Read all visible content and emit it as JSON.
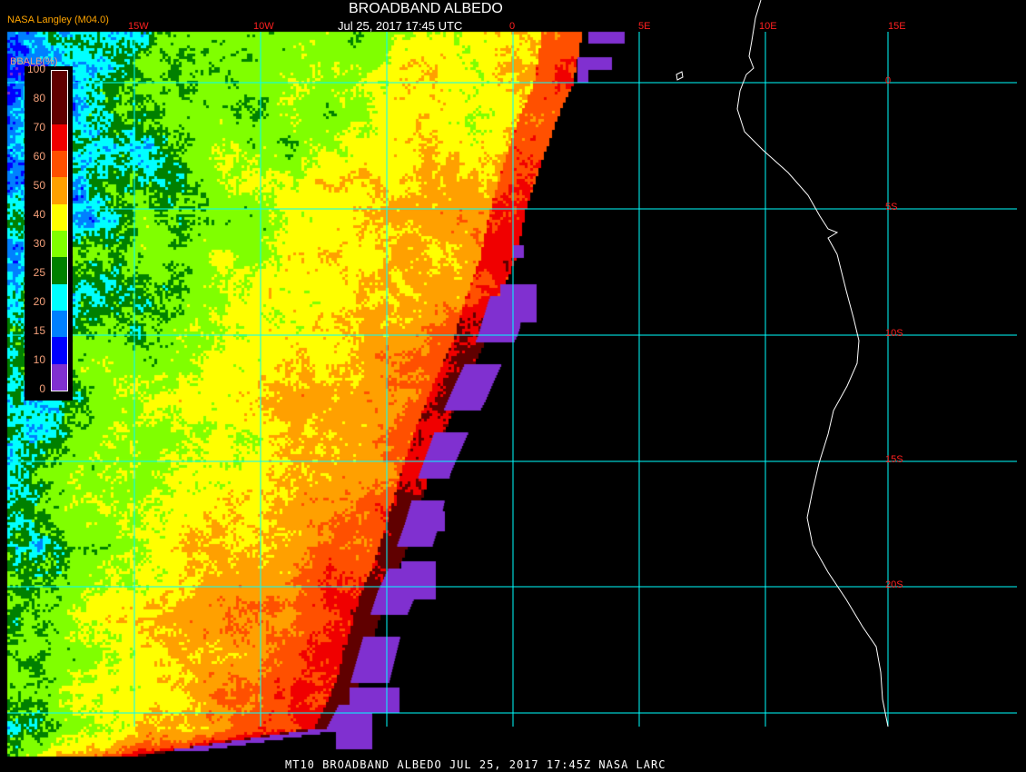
{
  "header": {
    "title": "BROADBAND ALBEDO",
    "subtitle": "Jul 25, 2017 17:45 UTC",
    "source": "NASA Langley (M04.0)"
  },
  "caption": "MT10  BROADBAND ALBEDO  JUL 25, 2017 17:45Z  NASA LARC",
  "longitude_labels": [
    "15W",
    "10W",
    "0",
    "5E",
    "10E",
    "15E"
  ],
  "latitude_labels": [
    "0",
    "5S",
    "10S",
    "15S",
    "20S"
  ],
  "legend": {
    "title": "BBALB(%)",
    "ticks": [
      "100",
      "80",
      "70",
      "60",
      "50",
      "40",
      "30",
      "25",
      "20",
      "15",
      "10",
      "0"
    ],
    "bins": [
      {
        "range": "90-100",
        "color": "#600000"
      },
      {
        "range": "80-90",
        "color": "#600000"
      },
      {
        "range": "70-80",
        "color": "#f00000"
      },
      {
        "range": "60-70",
        "color": "#ff5000"
      },
      {
        "range": "50-60",
        "color": "#ffa000"
      },
      {
        "range": "40-50",
        "color": "#ffff00"
      },
      {
        "range": "30-40",
        "color": "#80ff00"
      },
      {
        "range": "25-30",
        "color": "#008000"
      },
      {
        "range": "20-25",
        "color": "#00ffff"
      },
      {
        "range": "15-20",
        "color": "#0080ff"
      },
      {
        "range": "10-15",
        "color": "#0000ff"
      },
      {
        "range": "0-10",
        "color": "#8030d0"
      }
    ]
  },
  "colors": {
    "grid": "#00ffff",
    "coastline": "#ffffff",
    "labels": "#ff2020",
    "no_data": "#000000"
  }
}
